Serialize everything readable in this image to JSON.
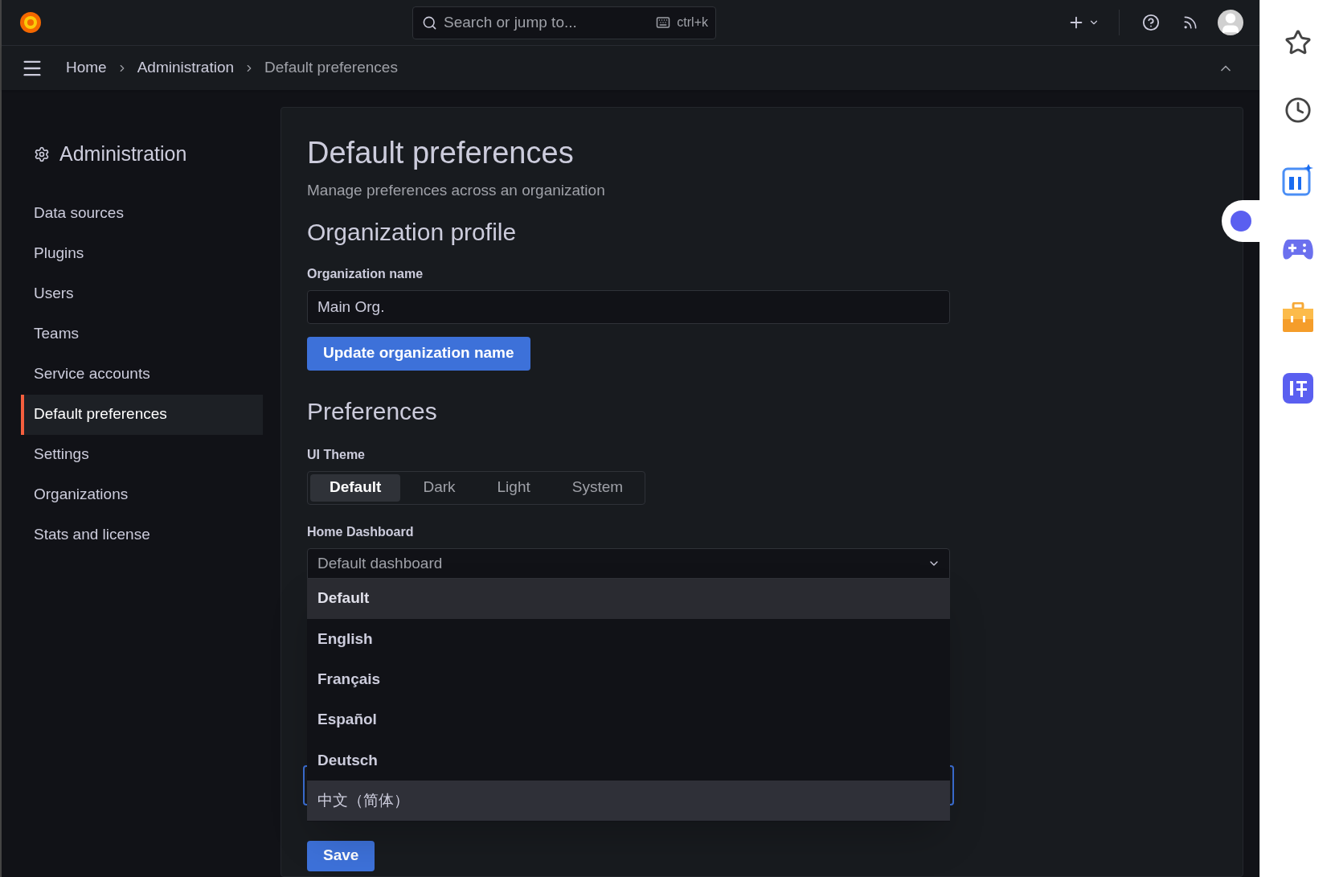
{
  "topbar": {
    "search": {
      "placeholder": "Search or jump to...",
      "shortcut": "ctrl+k"
    }
  },
  "breadcrumbs": [
    "Home",
    "Administration",
    "Default preferences"
  ],
  "sidebar": {
    "title": "Administration",
    "items": [
      {
        "label": "Data sources",
        "selected": false
      },
      {
        "label": "Plugins",
        "selected": false
      },
      {
        "label": "Users",
        "selected": false
      },
      {
        "label": "Teams",
        "selected": false
      },
      {
        "label": "Service accounts",
        "selected": false
      },
      {
        "label": "Default preferences",
        "selected": true
      },
      {
        "label": "Settings",
        "selected": false
      },
      {
        "label": "Organizations",
        "selected": false
      },
      {
        "label": "Stats and license",
        "selected": false
      }
    ]
  },
  "page": {
    "title": "Default preferences",
    "subtitle": "Manage preferences across an organization",
    "org_profile": {
      "heading": "Organization profile",
      "label": "Organization name",
      "value": "Main Org.",
      "button": "Update organization name"
    },
    "preferences": {
      "heading": "Preferences",
      "theme_label": "UI Theme",
      "themes": [
        {
          "label": "Default",
          "selected": true
        },
        {
          "label": "Dark",
          "selected": false
        },
        {
          "label": "Light",
          "selected": false
        },
        {
          "label": "System",
          "selected": false
        }
      ],
      "home_label": "Home Dashboard",
      "home_placeholder": "Default dashboard",
      "menu_options": [
        {
          "label": "Default",
          "hovered": true,
          "selected": false
        },
        {
          "label": "English",
          "hovered": false,
          "selected": false
        },
        {
          "label": "Français",
          "hovered": false,
          "selected": false
        },
        {
          "label": "Español",
          "hovered": false,
          "selected": false
        },
        {
          "label": "Deutsch",
          "hovered": false,
          "selected": false
        },
        {
          "label": "中文（简体）",
          "hovered": false,
          "selected": true
        }
      ],
      "save": "Save"
    }
  }
}
